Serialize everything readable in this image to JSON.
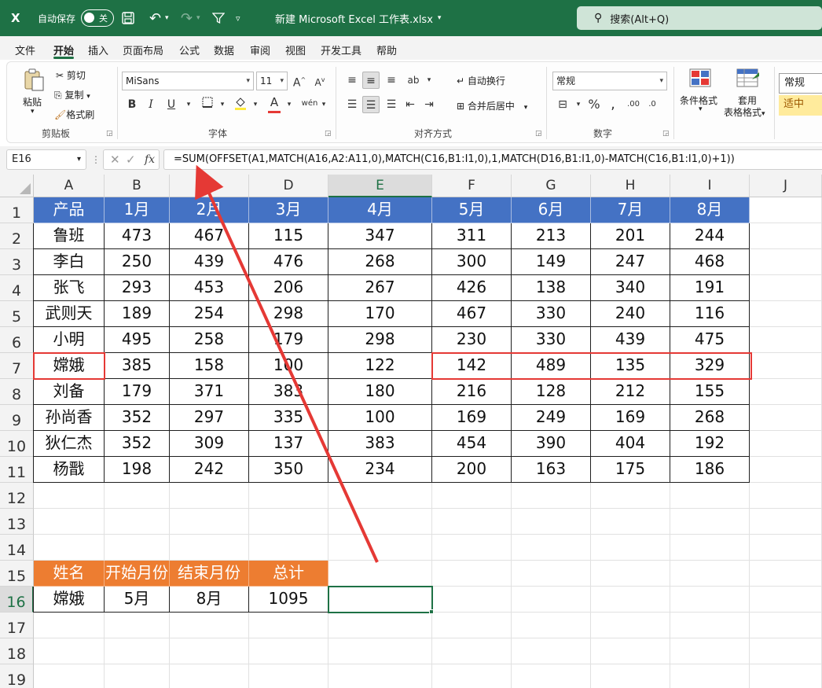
{
  "titlebar": {
    "logo": "X",
    "autosave_label": "自动保存",
    "autosave_state": "关",
    "doc_title": "新建 Microsoft Excel 工作表.xlsx",
    "search_placeholder": "搜索(Alt+Q)"
  },
  "menu": {
    "tabs": [
      "文件",
      "开始",
      "插入",
      "页面布局",
      "公式",
      "数据",
      "审阅",
      "视图",
      "开发工具",
      "帮助"
    ],
    "active": "开始"
  },
  "ribbon": {
    "clipboard": {
      "paste": "粘贴",
      "cut": "剪切",
      "copy": "复制",
      "format_painter": "格式刷",
      "label": "剪贴板"
    },
    "font": {
      "name": "MiSans",
      "size": "11",
      "label": "字体",
      "bold": "B",
      "italic": "I",
      "underline": "U"
    },
    "alignment": {
      "wrap": "自动换行",
      "merge": "合并后居中",
      "label": "对齐方式"
    },
    "number": {
      "format": "常规",
      "label": "数字"
    },
    "styles": {
      "cond_format": "条件格式",
      "table_format_1": "套用",
      "table_format_2": "表格格式",
      "style_normal": "常规",
      "style_medium": "适中"
    }
  },
  "formula_bar": {
    "name_box": "E16",
    "fx": "fx",
    "formula": "=SUM(OFFSET(A1,MATCH(A16,A2:A11,0),MATCH(C16,B1:I1,0),1,MATCH(D16,B1:I1,0)-MATCH(C16,B1:I1,0)+1))"
  },
  "sheet": {
    "columns": [
      "A",
      "B",
      "C",
      "D",
      "E",
      "F",
      "G",
      "H",
      "I",
      "J"
    ],
    "rows": [
      "1",
      "2",
      "3",
      "4",
      "5",
      "6",
      "7",
      "8",
      "9",
      "10",
      "11",
      "12",
      "13",
      "14",
      "15",
      "16",
      "17",
      "18",
      "19"
    ],
    "selected_col": "E",
    "selected_row": "16",
    "main_table": {
      "header": [
        "产品",
        "1月",
        "2月",
        "3月",
        "4月",
        "5月",
        "6月",
        "7月",
        "8月"
      ],
      "rows": [
        [
          "鲁班",
          "473",
          "467",
          "115",
          "347",
          "311",
          "213",
          "201",
          "244"
        ],
        [
          "李白",
          "250",
          "439",
          "476",
          "268",
          "300",
          "149",
          "247",
          "468"
        ],
        [
          "张飞",
          "293",
          "453",
          "206",
          "267",
          "426",
          "138",
          "340",
          "191"
        ],
        [
          "武则天",
          "189",
          "254",
          "298",
          "170",
          "467",
          "330",
          "240",
          "116"
        ],
        [
          "小明",
          "495",
          "258",
          "179",
          "298",
          "230",
          "330",
          "439",
          "475"
        ],
        [
          "嫦娥",
          "385",
          "158",
          "100",
          "122",
          "142",
          "489",
          "135",
          "329"
        ],
        [
          "刘备",
          "179",
          "371",
          "383",
          "180",
          "216",
          "128",
          "212",
          "155"
        ],
        [
          "孙尚香",
          "352",
          "297",
          "335",
          "100",
          "169",
          "249",
          "169",
          "268"
        ],
        [
          "狄仁杰",
          "352",
          "309",
          "137",
          "383",
          "454",
          "390",
          "404",
          "192"
        ],
        [
          "杨戬",
          "198",
          "242",
          "350",
          "234",
          "200",
          "163",
          "175",
          "186"
        ]
      ]
    },
    "lookup_table": {
      "header": [
        "姓名",
        "开始月份",
        "结束月份",
        "总计"
      ],
      "row": [
        "嫦娥",
        "5月",
        "8月",
        "1095"
      ]
    }
  },
  "colors": {
    "excel_green": "#1e7145",
    "header_blue": "#4472c4",
    "header_orange": "#ed7d31",
    "highlight_red": "#e53935"
  }
}
